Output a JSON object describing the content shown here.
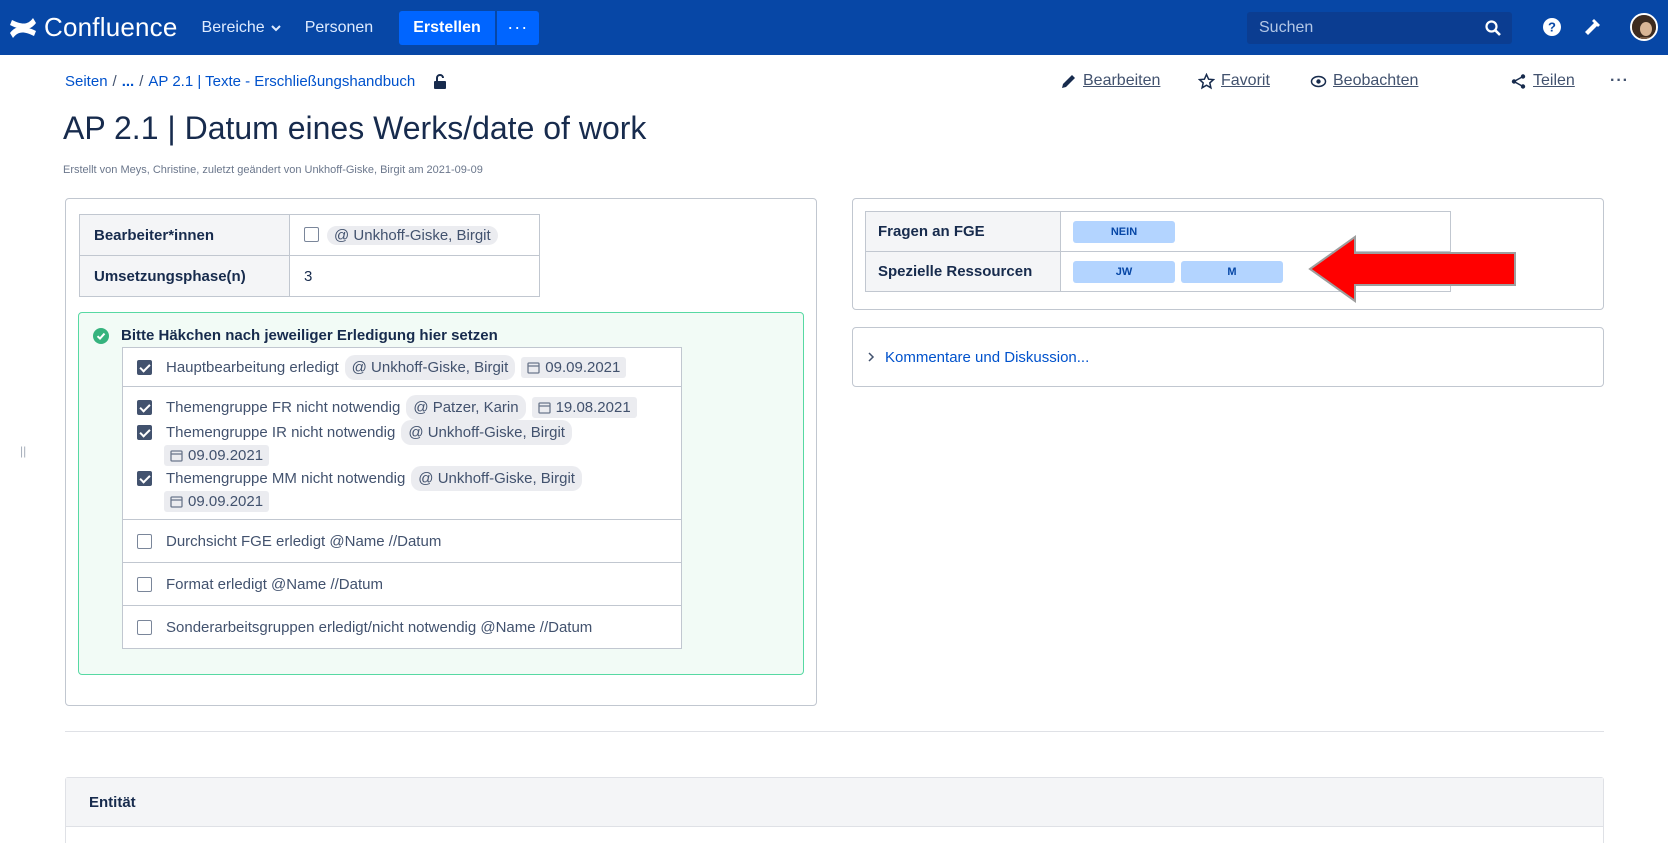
{
  "topbar": {
    "brand": "Confluence",
    "nav": [
      "Bereiche",
      "Personen"
    ],
    "create_label": "Erstellen",
    "more_label": "···",
    "search_placeholder": "Suchen"
  },
  "breadcrumb": {
    "root": "Seiten",
    "ellipsis": "...",
    "parent": "AP 2.1 | Texte - Erschließungshandbuch"
  },
  "actions": {
    "edit": "Bearbeiten",
    "favorite": "Favorit",
    "watch": "Beobachten",
    "share": "Teilen",
    "more": "···"
  },
  "page": {
    "title": "AP 2.1 | Datum eines Werks/date of work",
    "byline": "Erstellt von Meys, Christine, zuletzt geändert von Unkhoff-Giske, Birgit am 2021-09-09"
  },
  "meta": {
    "editors_label": "Bearbeiter*innen",
    "editors_value": "@ Unkhoff-Giske, Birgit",
    "phase_label": "Umsetzungsphase(n)",
    "phase_value": "3"
  },
  "tasks": {
    "title": "Bitte Häkchen nach jeweiliger Erledigung hier setzen",
    "main_text": "Hauptbearbeitung erledigt",
    "main_mention": "@ Unkhoff-Giske, Birgit",
    "main_date": "09.09.2021",
    "fr_text": "Themengruppe FR nicht notwendig",
    "fr_mention": "@ Patzer, Karin",
    "fr_date": "19.08.2021",
    "ir_text": "Themengruppe IR nicht notwendig",
    "ir_mention": "@ Unkhoff-Giske, Birgit",
    "ir_date": "09.09.2021",
    "mm_text": "Themengruppe MM nicht notwendig",
    "mm_mention": "@ Unkhoff-Giske, Birgit",
    "mm_date": "09.09.2021",
    "fge_text": "Durchsicht FGE erledigt @Name //Datum",
    "format_text": "Format erledigt @Name //Datum",
    "special_text": "Sonderarbeitsgruppen erledigt/nicht notwendig @Name //Datum"
  },
  "resources": {
    "questions_label": "Fragen an FGE",
    "questions_status": "NEIN",
    "special_label": "Spezielle Ressourcen",
    "special_status_1": "JW",
    "special_status_2": "M"
  },
  "comments": {
    "label": "Kommentare und Diskussion..."
  },
  "entity": {
    "header": "Entität"
  },
  "colors": {
    "nav_bg": "#0747a6",
    "create_bg": "#0065ff",
    "success_border": "#57d9a3",
    "status_bg": "#b3d4ff",
    "arrow": "#ff0000"
  }
}
